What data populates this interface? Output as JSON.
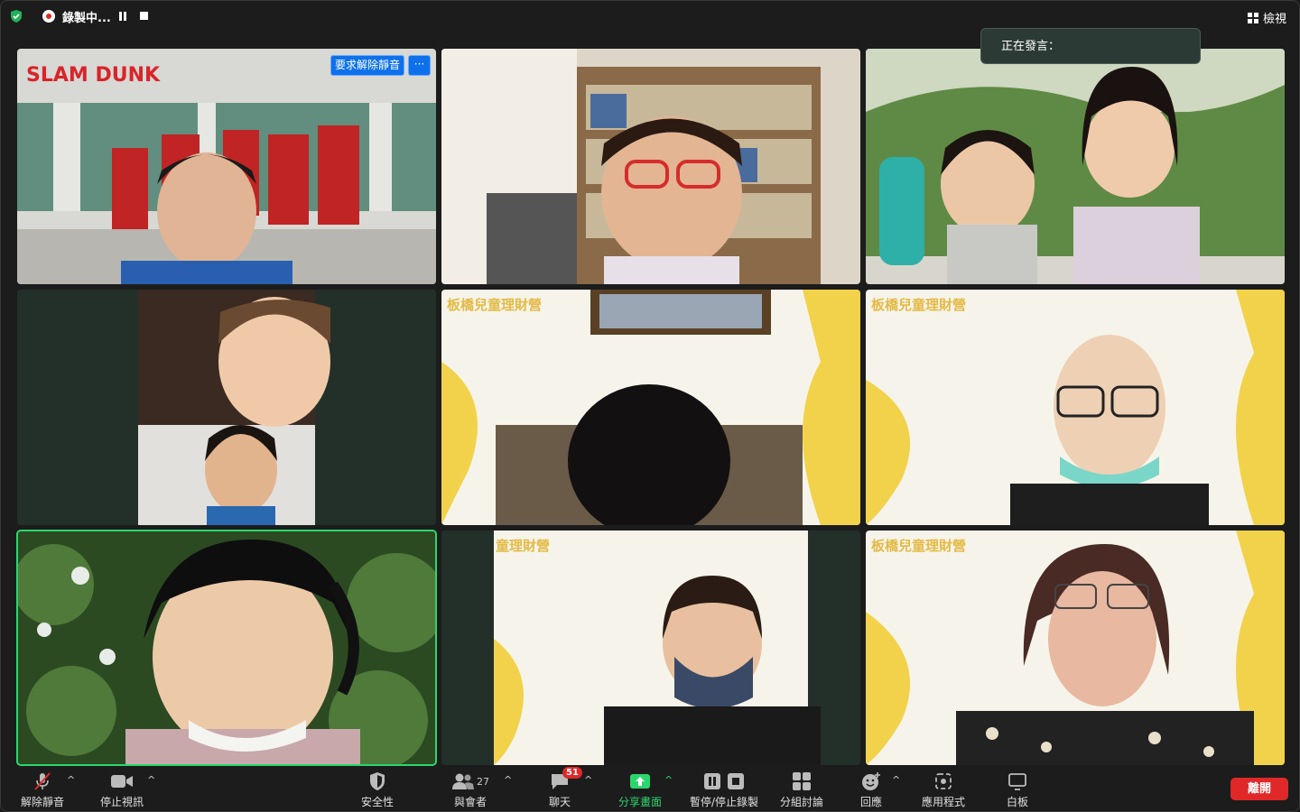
{
  "topbar": {
    "recording_label": "錄製中...",
    "view_label": "檢視"
  },
  "speaking_popup": {
    "label": "正在發言："
  },
  "tiles": {
    "tile1": {
      "unmute_request": "要求解除靜音",
      "more": "···"
    },
    "tile5": {
      "overlay": "板橋兒童理財營"
    },
    "tile6": {
      "overlay": "板橋兒童理財營"
    },
    "tile8": {
      "overlay": "童理財營"
    },
    "tile9": {
      "overlay": "板橋兒童理財營"
    }
  },
  "toolbar": {
    "unmute": "解除靜音",
    "stop_video": "停止視訊",
    "security": "安全性",
    "participants": "與會者",
    "participants_count": "27",
    "chat": "聊天",
    "chat_badge": "51",
    "share": "分享畫面",
    "record": "暫停/停止錄製",
    "breakout": "分組討論",
    "reactions": "回應",
    "apps": "應用程式",
    "whiteboard": "白板",
    "leave": "離開"
  },
  "colors": {
    "accent_green": "#2bd66e",
    "leave_red": "#e02828",
    "unmute_blue": "#0e71eb",
    "background": "#1c1c1c"
  }
}
